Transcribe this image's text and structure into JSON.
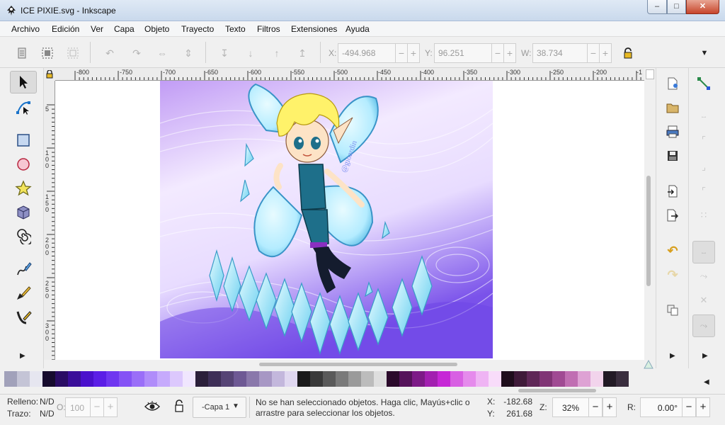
{
  "window": {
    "title": "ICE PIXIE.svg - Inkscape",
    "minimize_glyph": "–",
    "maximize_glyph": "□",
    "close_glyph": "✕"
  },
  "menu": [
    "Archivo",
    "Edición",
    "Ver",
    "Capa",
    "Objeto",
    "Trayecto",
    "Texto",
    "Filtros",
    "Extensiones",
    "Ayuda"
  ],
  "controls": {
    "x_label": "X:",
    "x_value": "-494.968",
    "y_label": "Y:",
    "y_value": "96.251",
    "w_label": "W:",
    "w_value": "38.734",
    "spin_minus": "−",
    "spin_plus": "+"
  },
  "ruler_top_labels": [
    "-800",
    "-750",
    "-700",
    "-650",
    "-600",
    "-550",
    "-500",
    "-450",
    "-400",
    "-350",
    "-300",
    "-250",
    "-200",
    "-1"
  ],
  "ruler_left_labels": [
    "5",
    "1\n0\n0",
    "1\n5\n0",
    "2\n0\n0",
    "2\n5\n0",
    "3\n0\n0"
  ],
  "artwork": {
    "signature": "@gioardin",
    "colors": {
      "bg_light": "#f2e8ff",
      "bg_purple": "#9b6cf0",
      "bg_deep": "#7048e8",
      "wing": "#bfefff",
      "wing_edge": "#4aa8d8",
      "hair": "#fff26a",
      "skin": "#fde3c6",
      "suit": "#1e6f8a",
      "crystal": "#a9ecff"
    }
  },
  "palette": [
    "#a1a1ba",
    "#c4c4d6",
    "#e6e6f0",
    "#160b2e",
    "#2a0c64",
    "#3a0e99",
    "#4a10cc",
    "#5b1ee6",
    "#6f36f0",
    "#8552f5",
    "#9a6ef8",
    "#b08cfa",
    "#c6aafc",
    "#dcc8fd",
    "#f0e6fe",
    "#2b1f3a",
    "#3e2f57",
    "#564475",
    "#6e5994",
    "#8a78ab",
    "#a797c4",
    "#c3b7dc",
    "#e0d8f0",
    "#1a1a1a",
    "#3a3a3a",
    "#5a5a5a",
    "#7a7a7a",
    "#9a9a9a",
    "#bcbcbc",
    "#dedede",
    "#2b0a2b",
    "#55125a",
    "#7d1a87",
    "#a21fb0",
    "#c627d6",
    "#d85fe3",
    "#e58aec",
    "#efb4f4",
    "#f8dcfa",
    "#1f0d1c",
    "#3f1a39",
    "#5f2757",
    "#803475",
    "#a04a93",
    "#c06eb2",
    "#dea2d4",
    "#f2d4ec",
    "#221a25",
    "#3a2e3e"
  ],
  "status": {
    "fill_label": "Relleno:",
    "fill_value": "N/D",
    "stroke_label": "Trazo:",
    "stroke_value": "N/D",
    "opacity_label": "O:",
    "opacity_value": "100",
    "layer": "-Capa 1",
    "message": "No se han seleccionado objetos. Haga clic, Mayús+clic o arrastre para seleccionar los objetos.",
    "x_label": "X:",
    "x_value": "-182.68",
    "y_label": "Y:",
    "y_value": "261.68",
    "zoom_label": "Z:",
    "zoom_value": "32%",
    "rotation_label": "R:",
    "rotation_value": "0.00°",
    "spin_minus": "−",
    "spin_plus": "+"
  }
}
